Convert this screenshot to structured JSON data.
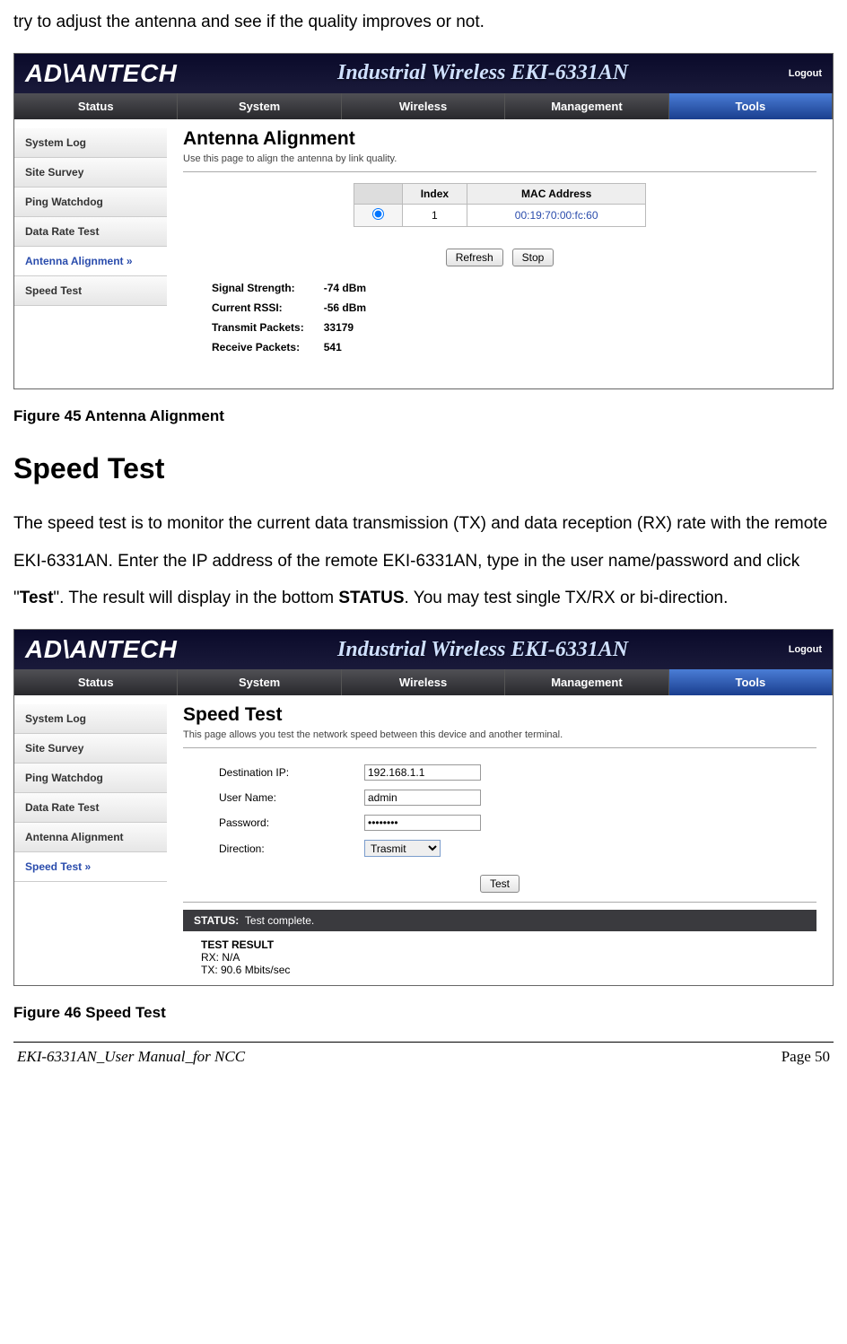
{
  "intro_text": "try to adjust the antenna and see if the quality improves or not.",
  "brand": "AD\\ANTECH",
  "product": "Industrial Wireless EKI-6331AN",
  "logout": "Logout",
  "nav": [
    "Status",
    "System",
    "Wireless",
    "Management",
    "Tools"
  ],
  "sidebar_items": [
    "System Log",
    "Site Survey",
    "Ping Watchdog",
    "Data Rate Test",
    "Antenna Alignment",
    "Speed Test"
  ],
  "fig45": {
    "title": "Antenna Alignment",
    "sub": "Use this page to align the antenna by link quality.",
    "table_headers": [
      "",
      "Index",
      "MAC Address"
    ],
    "row": {
      "index": "1",
      "mac": "00:19:70:00:fc:60"
    },
    "buttons": [
      "Refresh",
      "Stop"
    ],
    "stats": [
      [
        "Signal Strength:",
        "-74 dBm"
      ],
      [
        "Current RSSI:",
        "-56 dBm"
      ],
      [
        "Transmit Packets:",
        "33179"
      ],
      [
        "Receive Packets:",
        "541"
      ]
    ],
    "caption": "Figure 45 Antenna Alignment"
  },
  "speed_test": {
    "heading": "Speed Test",
    "body_parts": [
      "The speed test is to monitor the current data transmission (TX) and data reception (RX) rate with the remote EKI-6331AN.   Enter the IP address of the remote EKI-6331AN, type in the user name/password and click \"",
      "Test",
      "\".   The result will display in the bottom ",
      "STATUS",
      ".   You may test single TX/RX or bi-direction."
    ]
  },
  "fig46": {
    "title": "Speed Test",
    "sub": "This page allows you test the network speed between this device and another terminal.",
    "fields": [
      [
        "Destination IP:",
        "192.168.1.1"
      ],
      [
        "User Name:",
        "admin"
      ],
      [
        "Password:",
        "********"
      ],
      [
        "Direction:",
        "Trasmit"
      ]
    ],
    "test_btn": "Test",
    "status_label": "STATUS:",
    "status_text": "Test complete.",
    "result_title": "TEST RESULT",
    "result_rx": "RX: N/A",
    "result_tx": "TX:  90.6 Mbits/sec",
    "caption": "Figure 46 Speed Test"
  },
  "footer": {
    "left": "EKI-6331AN_User Manual_for NCC",
    "right": "Page 50"
  }
}
